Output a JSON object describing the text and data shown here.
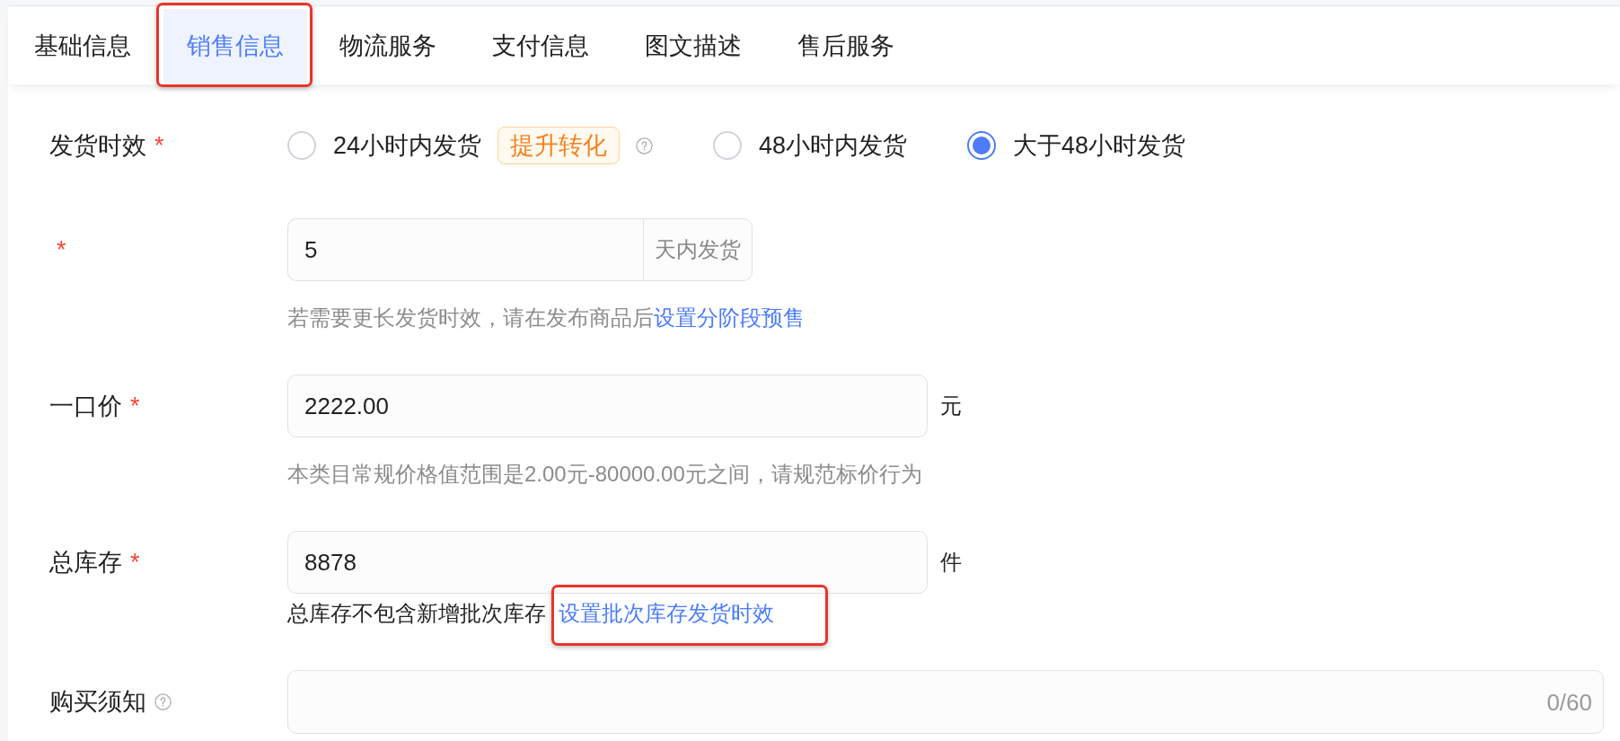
{
  "tabs": [
    {
      "label": "基础信息",
      "selected": false,
      "highlighted": false
    },
    {
      "label": "销售信息",
      "selected": true,
      "highlighted": true
    },
    {
      "label": "物流服务",
      "selected": false,
      "highlighted": false
    },
    {
      "label": "支付信息",
      "selected": false,
      "highlighted": false
    },
    {
      "label": "图文描述",
      "selected": false,
      "highlighted": false
    },
    {
      "label": "售后服务",
      "selected": false,
      "highlighted": false
    }
  ],
  "form": {
    "fields": [
      {
        "kind": "radio",
        "label": "发货时效",
        "required_mark": "*",
        "options": [
          {
            "label": "24小时内发货",
            "selected": false,
            "badge": "提升转化",
            "help_icon": true
          },
          {
            "label": "48小时内发货",
            "selected": false
          },
          {
            "label": "大于48小时发货",
            "selected": true
          }
        ]
      },
      {
        "kind": "input",
        "required_mark": "*",
        "value": "5",
        "suffix": "天内发货",
        "hint": {
          "muted": true,
          "text": "若需要更长发货时效，请在发布商品后",
          "link": {
            "text": "设置分阶段预售",
            "highlighted": false
          }
        }
      },
      {
        "kind": "input",
        "label": "一口价",
        "required_mark": "*",
        "value": "2222.00",
        "unit": "元",
        "hint": {
          "muted": true,
          "text": "本类目常规价格值范围是2.00元-80000.00元之间，请规范标价行为"
        }
      },
      {
        "kind": "input",
        "label": "总库存",
        "required_mark": "*",
        "value": "8878",
        "unit": "件",
        "hint": {
          "muted": false,
          "text": "总库存不包含新增批次库存",
          "link": {
            "text": "设置批次库存发货时效",
            "highlighted": true
          }
        }
      },
      {
        "kind": "textarea",
        "label": "购买须知",
        "help_icon": true,
        "counter": "0/60"
      }
    ]
  }
}
